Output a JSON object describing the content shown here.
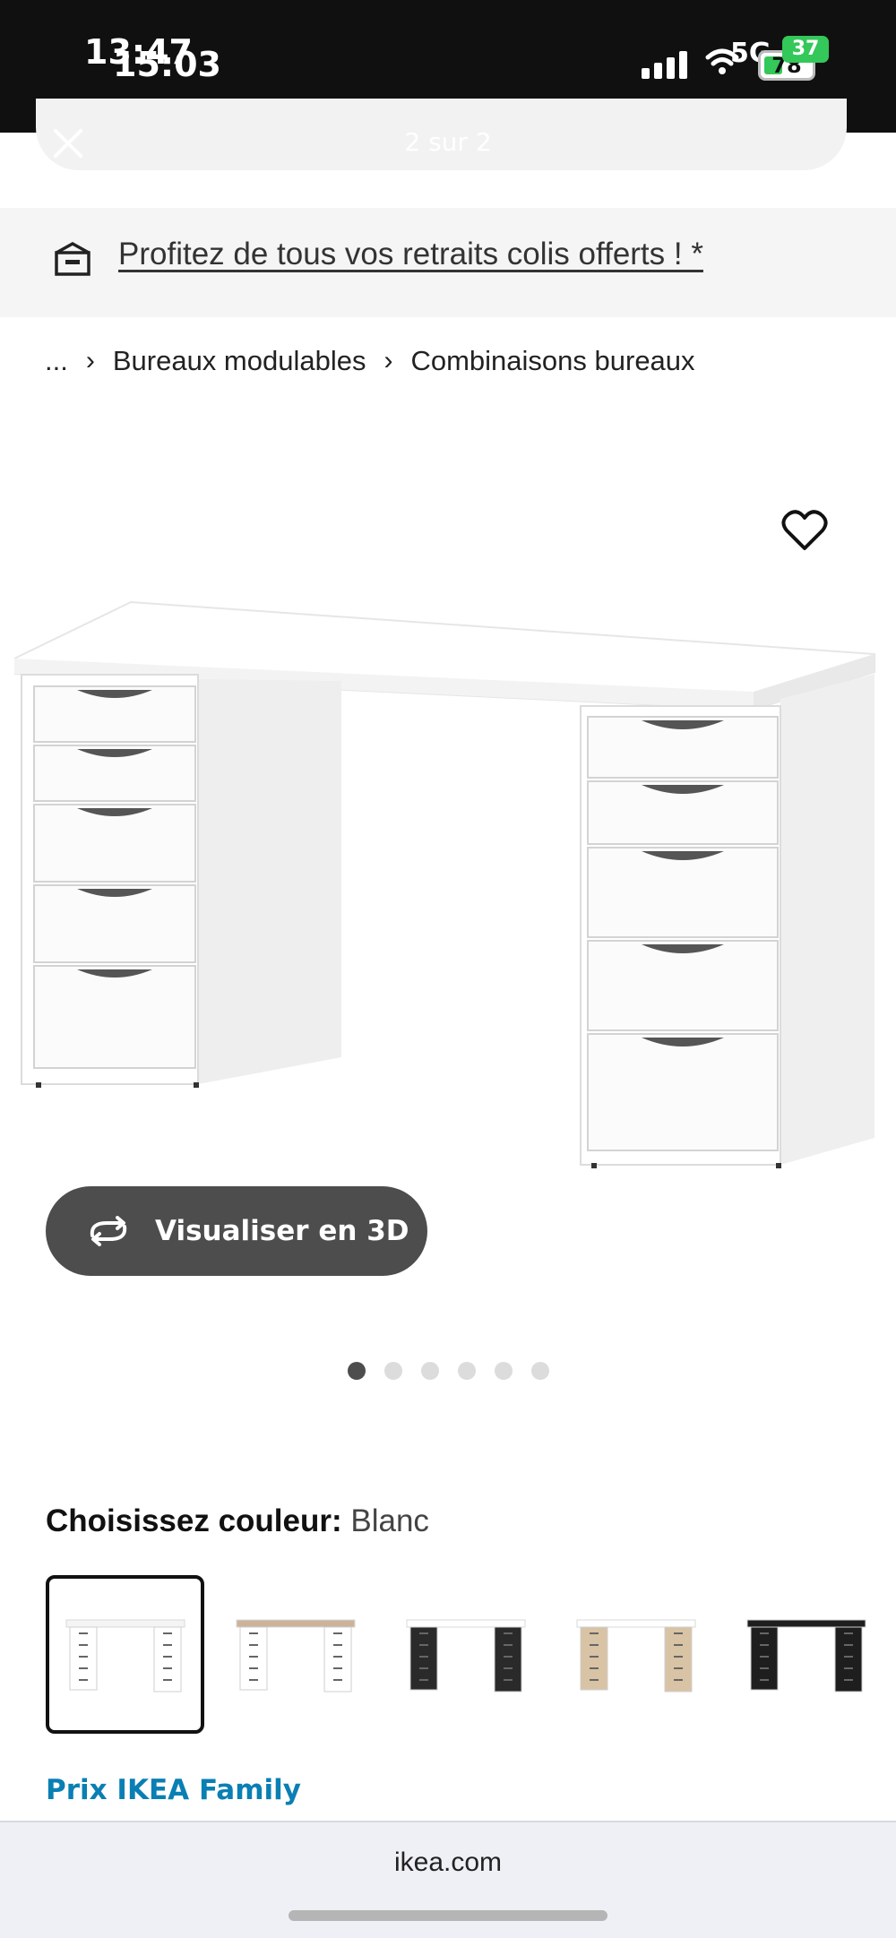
{
  "status_bar": {
    "time_primary": "13:47",
    "time_secondary": "15:03",
    "network": "5G",
    "battery_primary": "37",
    "battery_secondary": "78"
  },
  "viewer": {
    "counter": "2 sur 2"
  },
  "promo": {
    "text": "Profitez de tous vos retraits colis offerts ! *"
  },
  "breadcrumb": {
    "ellipsis": "...",
    "items": [
      "Bureaux modulables",
      "Combinaisons bureaux"
    ]
  },
  "gallery": {
    "view_3d_label": "Visualiser en 3D",
    "page_count": 6,
    "active_index": 0
  },
  "color": {
    "label": "Choisissez couleur:",
    "value": "Blanc",
    "swatches": [
      {
        "name": "Blanc",
        "top": "#f4f4f4",
        "drawer": "#ffffff",
        "selected": true
      },
      {
        "name": "Blanc/chêne",
        "top": "#cbb39a",
        "drawer": "#ffffff",
        "selected": false
      },
      {
        "name": "Blanc/noir",
        "top": "#ffffff",
        "drawer": "#2a2a2a",
        "selected": false
      },
      {
        "name": "Blanc/chêne teinté",
        "top": "#ffffff",
        "drawer": "#d9c3a5",
        "selected": false
      },
      {
        "name": "Noir-brun",
        "top": "#1e1e1e",
        "drawer": "#1e1e1e",
        "selected": false
      }
    ]
  },
  "family_price_label": "Prix IKEA Family",
  "browser": {
    "url": "ikea.com"
  },
  "colors": {
    "family_blue": "#0a7fb4",
    "button_dark": "#4d4d4d"
  }
}
